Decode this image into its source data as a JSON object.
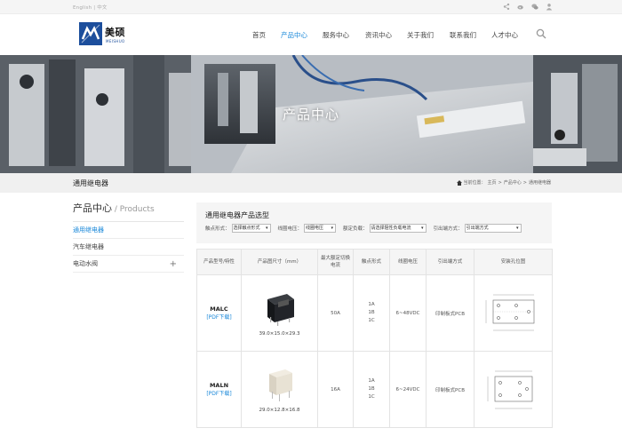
{
  "topbar": {
    "lang_en": "English",
    "lang_sep": "|",
    "lang_cn": "中文",
    "icons": [
      "share-icon",
      "weibo-icon",
      "wechat-icon",
      "user-icon"
    ]
  },
  "logo": {
    "cn": "美硕",
    "en": "MEISHUO"
  },
  "nav": [
    {
      "label": "首页",
      "active": false
    },
    {
      "label": "产品中心",
      "active": true
    },
    {
      "label": "服务中心",
      "active": false
    },
    {
      "label": "资讯中心",
      "active": false
    },
    {
      "label": "关于我们",
      "active": false
    },
    {
      "label": "联系我们",
      "active": false
    },
    {
      "label": "人才中心",
      "active": false
    }
  ],
  "banner": {
    "title": "产品中心"
  },
  "subbar": {
    "category": "通用继电器",
    "breadcrumb": {
      "prefix": "当前位置：",
      "items": [
        "主页",
        "产品中心",
        "通用继电器"
      ],
      "sep": ">"
    }
  },
  "sidebar": {
    "title": "产品中心",
    "title_sep": " / ",
    "title_en": "Products",
    "items": [
      {
        "label": "通用继电器",
        "active": true
      },
      {
        "label": "汽车继电器",
        "active": false
      },
      {
        "label": "电动水阀",
        "active": false,
        "expand": "+"
      }
    ]
  },
  "filter": {
    "title": "通用继电器产品选型",
    "fields": [
      {
        "label": "触点形式：",
        "value": "选择触点形式"
      },
      {
        "label": "线圈电压：",
        "value": "线圈电压"
      },
      {
        "label": "额定负载：",
        "value": "请选择阻性负载电流"
      },
      {
        "label": "引出端方式：",
        "value": "引出端方式"
      }
    ]
  },
  "table": {
    "headers": [
      "产品型号/特性",
      "产品图尺寸（mm）",
      "最大额定切换电流",
      "触点形式",
      "线圈电压",
      "引出端方式",
      "安装孔位图"
    ],
    "rows": [
      {
        "model": "MALC",
        "pdf": "[PDF下载]",
        "size": "39.0×15.0×29.3",
        "current": "50A",
        "contacts": [
          "1A",
          "1B",
          "1C"
        ],
        "voltage": "6~48VDC",
        "terminal": "印制板式PCB"
      },
      {
        "model": "MALN",
        "pdf": "[PDF下载]",
        "size": "29.0×12.8×16.8",
        "current": "16A",
        "contacts": [
          "1A",
          "1B",
          "1C"
        ],
        "voltage": "6~24VDC",
        "terminal": "印制板式PCB"
      }
    ]
  },
  "colors": {
    "accent": "#1a88d9",
    "logo_blue": "#1c4e9c"
  }
}
